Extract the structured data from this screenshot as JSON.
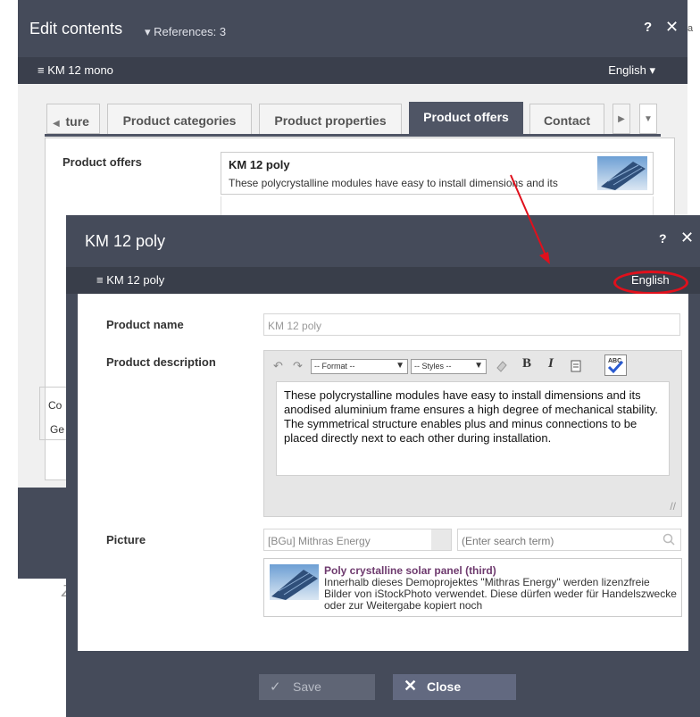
{
  "back_dialog": {
    "title": "Edit contents",
    "references": "▾ References: 3",
    "help": "?",
    "close": "✕",
    "subtitle": "≡ KM 12 mono",
    "language": "English ▾",
    "tabs": [
      {
        "label": "ture"
      },
      {
        "label": "Product categories"
      },
      {
        "label": "Product properties"
      },
      {
        "label": "Product offers"
      },
      {
        "label": "Contact"
      }
    ],
    "product_offers_label": "Product offers",
    "offer_title": "KM 12 poly",
    "offer_desc": "These polycrystalline modules have easy to install dimensions and its",
    "co_label": "Co",
    "ge_label": "Ge",
    "side_text": "Z",
    "corner_text": "a"
  },
  "front_dialog": {
    "title": "KM 12 poly",
    "help": "?",
    "close": "✕",
    "subtitle": "≡ KM 12 poly",
    "language": "English",
    "product_name_label": "Product name",
    "product_name_value": "KM 12 poly",
    "product_description_label": "Product description",
    "toolbar": {
      "format": "-- Format --",
      "styles": "-- Styles --",
      "bold": "B",
      "italic": "I"
    },
    "description_text": "These polycrystalline modules have easy to install dimensions and its anodised aluminium frame ensures a high degree of mechanical stability. The symmetrical structure enables plus and minus connections to be placed directly next to each other during installation.",
    "picture_label": "Picture",
    "picture_source": "[BGu] Mithras Energy",
    "search_placeholder": "(Enter search term)",
    "picture_title": "Poly crystalline solar panel (third)",
    "picture_desc": "Innerhalb dieses Demoprojektes \"Mithras Energy\" werden lizenzfreie Bilder von iStockPhoto verwendet. Diese dürfen weder für Handelszwecke oder zur Weitergabe kopiert noch",
    "save_label": "Save",
    "close_label": "Close"
  },
  "colors": {
    "dialog_bg": "#454b5a",
    "highlight_red": "#e0101c",
    "accent_tab": "#4f5565"
  }
}
